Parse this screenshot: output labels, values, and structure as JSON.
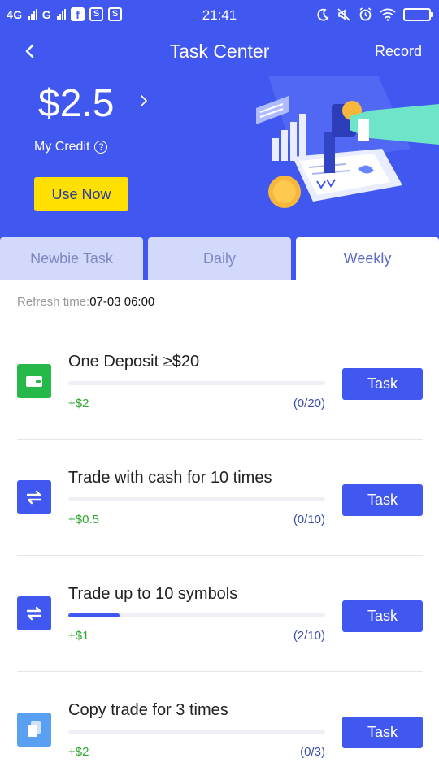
{
  "status_bar": {
    "network_1": "4G",
    "network_2": "G",
    "time": "21:41",
    "left_icons": [
      "facebook-icon",
      "s-app-icon",
      "s-app-icon"
    ],
    "right_icons": [
      "moon-icon",
      "mute-icon",
      "alarm-icon",
      "wifi-icon",
      "battery-icon"
    ]
  },
  "nav": {
    "title": "Task Center",
    "record_label": "Record"
  },
  "credit": {
    "amount": "$2.5",
    "label": "My Credit",
    "help_glyph": "?",
    "use_now_label": "Use Now"
  },
  "tabs": [
    {
      "label": "Newbie Task",
      "active": false
    },
    {
      "label": "Daily",
      "active": false
    },
    {
      "label": "Weekly",
      "active": true
    }
  ],
  "refresh": {
    "label": "Refresh time:",
    "value": "07-03 06:00"
  },
  "tasks": [
    {
      "title": "One Deposit ≥$20",
      "reward": "+$2",
      "progress_text": "(0/20)",
      "progress": 0.0,
      "button": "Task",
      "icon": "wallet-icon",
      "icon_color": "#27b84a"
    },
    {
      "title": "Trade with cash for 10 times",
      "reward": "+$0.5",
      "progress_text": "(0/10)",
      "progress": 0.0,
      "button": "Task",
      "icon": "swap-arrows-icon",
      "icon_color": "#4158f0"
    },
    {
      "title": "Trade up to 10 symbols",
      "reward": "+$1",
      "progress_text": "(2/10)",
      "progress": 0.2,
      "button": "Task",
      "icon": "swap-arrows-icon",
      "icon_color": "#4158f0"
    },
    {
      "title": "Copy trade for 3 times",
      "reward": "+$2",
      "progress_text": "(0/3)",
      "progress": 0.0,
      "button": "Task",
      "icon": "copy-document-icon",
      "icon_color": "#5aa0f2"
    }
  ],
  "colors": {
    "primary": "#4158f0",
    "accent_yellow": "#ffe000",
    "reward_green": "#2fa82f",
    "tab_inactive": "#d2d9fb"
  }
}
